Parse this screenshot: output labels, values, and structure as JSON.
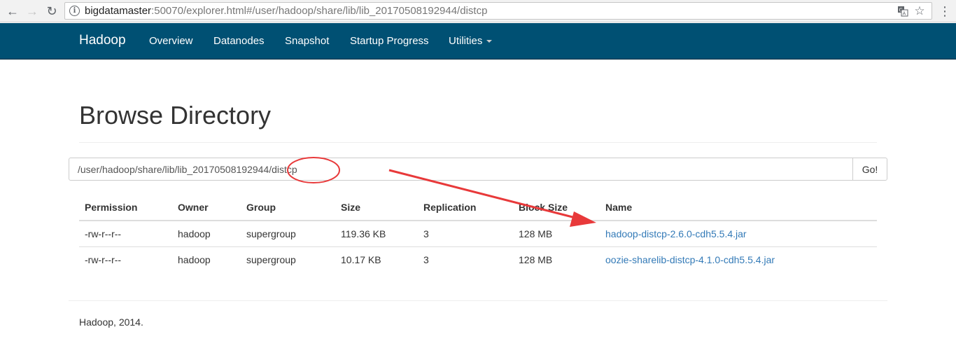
{
  "browser": {
    "url_host": "bigdatamaster",
    "url_rest": ":50070/explorer.html#/user/hadoop/share/lib/lib_20170508192944/distcp",
    "back_icon": "arrow-left-icon",
    "forward_icon": "arrow-right-icon",
    "reload_icon": "reload-icon",
    "info_icon": "info-icon",
    "translate_icon": "translate-icon",
    "star_icon": "star-icon",
    "menu_icon": "kebab-menu-icon"
  },
  "navbar": {
    "brand": "Hadoop",
    "items": [
      "Overview",
      "Datanodes",
      "Snapshot",
      "Startup Progress",
      "Utilities"
    ],
    "color": "#005073"
  },
  "page": {
    "title": "Browse Directory",
    "path_value": "/user/hadoop/share/lib/lib_20170508192944/distcp",
    "go_label": "Go!"
  },
  "table": {
    "headers": [
      "Permission",
      "Owner",
      "Group",
      "Size",
      "Replication",
      "Block Size",
      "Name"
    ],
    "rows": [
      [
        "-rw-r--r--",
        "hadoop",
        "supergroup",
        "119.36 KB",
        "3",
        "128 MB",
        "hadoop-distcp-2.6.0-cdh5.5.4.jar"
      ],
      [
        "-rw-r--r--",
        "hadoop",
        "supergroup",
        "10.17 KB",
        "3",
        "128 MB",
        "oozie-sharelib-distcp-4.1.0-cdh5.5.4.jar"
      ]
    ],
    "link_color": "#337ab7"
  },
  "footer": {
    "text": "Hadoop, 2014."
  },
  "annotation": {
    "color": "#e8393a"
  }
}
